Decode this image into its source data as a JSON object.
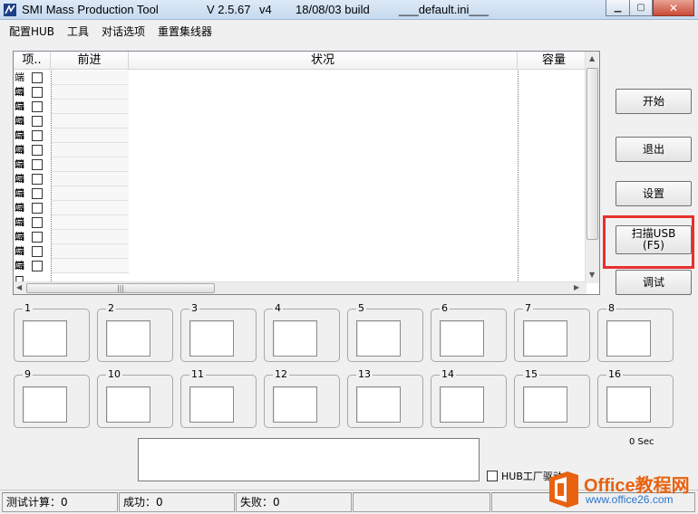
{
  "window": {
    "app_name": "SMI Mass Production Tool",
    "version": "V 2.5.67",
    "version_suffix": "v4",
    "build": "18/08/03 build",
    "ini_file": "___default.ini___",
    "controls": [
      "minimize",
      "maximize",
      "close"
    ]
  },
  "menu": [
    "配置HUB",
    "工具",
    "对话选项",
    "重置集线器"
  ],
  "list": {
    "columns": [
      "项..",
      "前进",
      "状况",
      "容量"
    ],
    "item_label": "端口",
    "rows": 14
  },
  "buttons": {
    "start": "开始",
    "exit": "退出",
    "settings": "设置",
    "scan_usb": "扫描USB\n(F5)",
    "debug": "调试"
  },
  "port_slots": [
    "1",
    "2",
    "3",
    "4",
    "5",
    "6",
    "7",
    "8",
    "9",
    "10",
    "11",
    "12",
    "13",
    "14",
    "15",
    "16"
  ],
  "timer": "0 Sec",
  "hub_driver_label": "HUB工厂驱动",
  "status": {
    "test_count": "测试计算：0",
    "success": "成功：0",
    "failure": "失败：0"
  },
  "watermark": {
    "title": "Office教程网",
    "url": "www.office26.com"
  },
  "colors": {
    "highlight": "#e8302f",
    "watermark_orange": "#e8620f",
    "watermark_blue": "#2b74c8"
  }
}
